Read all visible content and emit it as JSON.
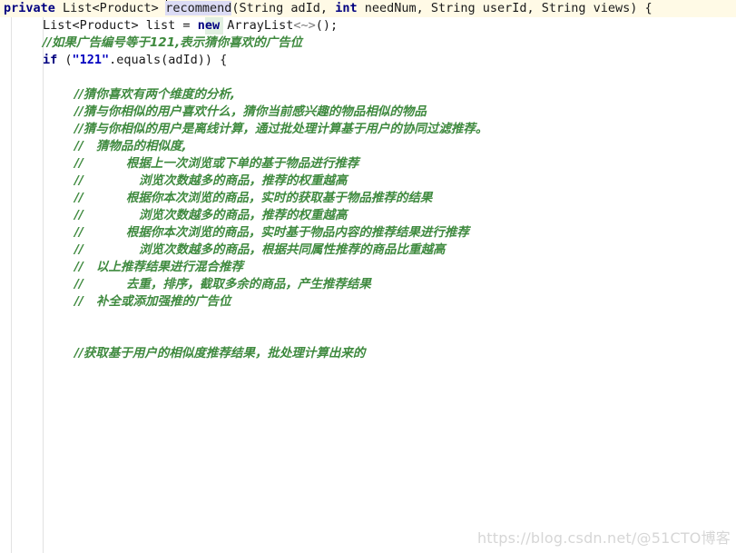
{
  "editor": {
    "language": "java",
    "colors": {
      "background": "#ffffff",
      "caret_line": "#fffae6",
      "keyword": "#000080",
      "string": "#0000c0",
      "comment": "#3f8a3f",
      "plain_text": "#1a1a1a",
      "identifier_highlight": "#dcdcf5",
      "indent_guide": "#e2e2e2",
      "watermark": "#d6d6d6"
    },
    "caret": {
      "line_index": 0,
      "before_token": "recommend"
    },
    "highlighted_identifier": "recommend(",
    "lines": [
      {
        "id": "line-signature",
        "indent": 0,
        "tokens": [
          {
            "type": "kw",
            "text": "private"
          },
          {
            "type": "plain",
            "text": " List<Product> "
          },
          {
            "type": "caret",
            "text": ""
          },
          {
            "type": "ident",
            "text": "recommend"
          },
          {
            "type": "plain",
            "text": "(String adId, "
          },
          {
            "type": "kw",
            "text": "int"
          },
          {
            "type": "plain",
            "text": " needNum, String userId, String views) {"
          }
        ]
      },
      {
        "id": "line-list-decl",
        "indent": 1,
        "tokens": [
          {
            "type": "plain",
            "text": "List<Product> list = "
          },
          {
            "type": "kw",
            "text": "new"
          },
          {
            "type": "plain",
            "text": " ArrayList"
          },
          {
            "type": "fold",
            "text": "<~>"
          },
          {
            "type": "plain",
            "text": "();"
          }
        ]
      },
      {
        "id": "line-comment-adid",
        "indent": 1,
        "tokens": [
          {
            "type": "cmt",
            "text": "//如果广告编号等于121,表示猜你喜欢的广告位"
          }
        ]
      },
      {
        "id": "line-if",
        "indent": 1,
        "tokens": [
          {
            "type": "kw",
            "text": "if"
          },
          {
            "type": "plain",
            "text": " ("
          },
          {
            "type": "str",
            "text": "\"121\""
          },
          {
            "type": "plain",
            "text": ".equals(adId)) {"
          }
        ]
      },
      {
        "id": "line-blank-1",
        "indent": 0,
        "tokens": []
      },
      {
        "id": "line-comment-two-dims",
        "indent": 2,
        "tokens": [
          {
            "type": "cmt",
            "text": "//猜你喜欢有两个维度的分析,"
          }
        ]
      },
      {
        "id": "line-comment-similar-users",
        "indent": 2,
        "tokens": [
          {
            "type": "cmt",
            "text": "//猜与你相似的用户喜欢什么，猜你当前感兴趣的物品相似的物品"
          }
        ]
      },
      {
        "id": "line-comment-offline",
        "indent": 2,
        "tokens": [
          {
            "type": "cmt",
            "text": "//猜与你相似的用户是离线计算，通过批处理计算基于用户的协同过滤推荐。"
          }
        ]
      },
      {
        "id": "line-comment-item-sim",
        "indent": 2,
        "tokens": [
          {
            "type": "cmt",
            "text": "//   猜物品的相似度,"
          }
        ]
      },
      {
        "id": "line-comment-last-browse",
        "indent": 2,
        "tokens": [
          {
            "type": "cmt",
            "text": "//          根据上一次浏览或下单的基于物品进行推荐"
          }
        ]
      },
      {
        "id": "line-comment-weight-1",
        "indent": 2,
        "tokens": [
          {
            "type": "cmt",
            "text": "//             浏览次数越多的商品，推荐的权重越高"
          }
        ]
      },
      {
        "id": "line-comment-realtime",
        "indent": 2,
        "tokens": [
          {
            "type": "cmt",
            "text": "//          根据你本次浏览的商品，实时的获取基于物品推荐的结果"
          }
        ]
      },
      {
        "id": "line-comment-weight-2",
        "indent": 2,
        "tokens": [
          {
            "type": "cmt",
            "text": "//             浏览次数越多的商品，推荐的权重越高"
          }
        ]
      },
      {
        "id": "line-comment-content",
        "indent": 2,
        "tokens": [
          {
            "type": "cmt",
            "text": "//          根据你本次浏览的商品，实时基于物品内容的推荐结果进行推荐"
          }
        ]
      },
      {
        "id": "line-comment-attr",
        "indent": 2,
        "tokens": [
          {
            "type": "cmt",
            "text": "//             浏览次数越多的商品，根据共同属性推荐的商品比重越高"
          }
        ]
      },
      {
        "id": "line-comment-mix",
        "indent": 2,
        "tokens": [
          {
            "type": "cmt",
            "text": "//   以上推荐结果进行混合推荐"
          }
        ]
      },
      {
        "id": "line-comment-dedupe",
        "indent": 2,
        "tokens": [
          {
            "type": "cmt",
            "text": "//          去重，排序，截取多余的商品，产生推荐结果"
          }
        ]
      },
      {
        "id": "line-comment-fill",
        "indent": 2,
        "tokens": [
          {
            "type": "cmt",
            "text": "//   补全或添加强推的广告位"
          }
        ]
      },
      {
        "id": "line-blank-2",
        "indent": 0,
        "tokens": []
      },
      {
        "id": "line-blank-3",
        "indent": 0,
        "tokens": []
      },
      {
        "id": "line-comment-fetch",
        "indent": 2,
        "tokens": [
          {
            "type": "cmt",
            "text": "//获取基于用户的相似度推荐结果，批处理计算出来的"
          }
        ]
      }
    ]
  },
  "watermark": {
    "text": "https://blog.csdn.net/@51CTO博客"
  }
}
